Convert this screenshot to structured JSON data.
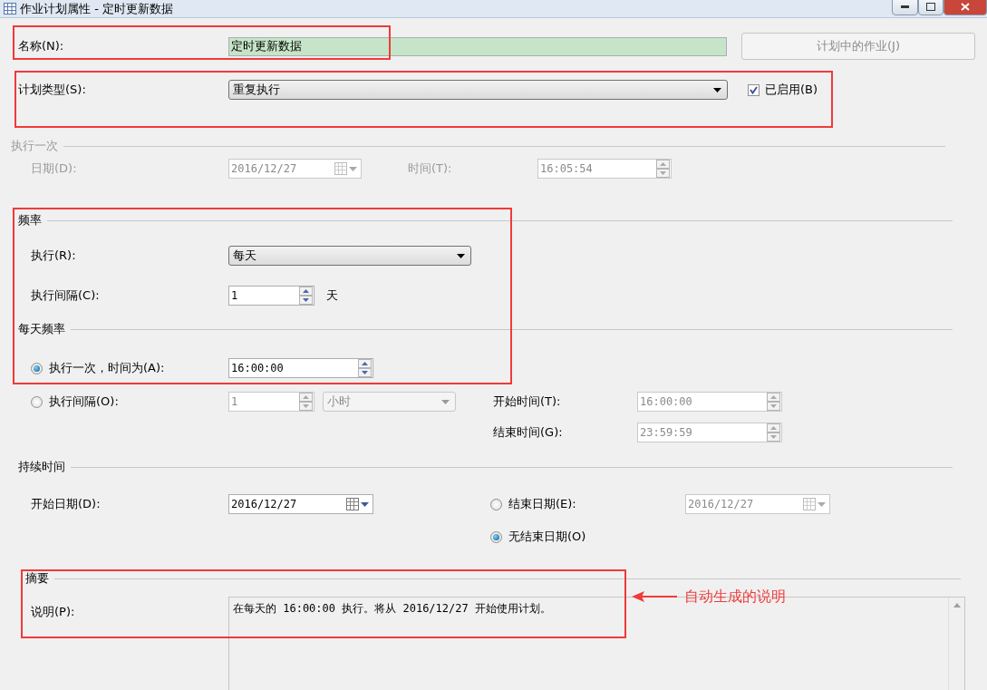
{
  "window": {
    "title": "作业计划属性 - 定时更新数据"
  },
  "name_field": {
    "label": "名称(N):",
    "value": "定时更新数据"
  },
  "jobs_button": {
    "label": "计划中的作业(J)",
    "disabled": true
  },
  "schedule_type": {
    "label": "计划类型(S):",
    "value": "重复执行"
  },
  "enabled": {
    "label": "已启用(B)",
    "checked": true
  },
  "one_time": {
    "title": "执行一次",
    "disabled": true,
    "date_label": "日期(D):",
    "date_value": "2016/12/27",
    "time_label": "时间(T):",
    "time_value": "16:05:54"
  },
  "frequency": {
    "title": "频率",
    "occurs_label": "执行(R):",
    "occurs_value": "每天",
    "interval_label": "执行间隔(C):",
    "interval_value": "1",
    "interval_unit": "天"
  },
  "daily_frequency": {
    "title": "每天频率",
    "options": [
      {
        "kind": "once",
        "label": "执行一次，时间为(A):",
        "selected": true,
        "value": "16:00:00"
      },
      {
        "kind": "every",
        "label": "执行间隔(O):",
        "selected": false,
        "value": "1",
        "unit": "小时",
        "start_label": "开始时间(T):",
        "start_value": "16:00:00",
        "end_label": "结束时间(G):",
        "end_value": "23:59:59"
      }
    ]
  },
  "duration": {
    "title": "持续时间",
    "start_label": "开始日期(D):",
    "start_value": "2016/12/27",
    "end_options": [
      {
        "label": "结束日期(E):",
        "selected": false,
        "value": "2016/12/27"
      },
      {
        "label": "无结束日期(O)",
        "selected": true
      }
    ]
  },
  "summary": {
    "title": "摘要",
    "description_label": "说明(P):",
    "description": "在每天的 16:00:00 执行。将从 2016/12/27 开始使用计划。"
  },
  "annotation": {
    "callout": "自动生成的说明"
  }
}
